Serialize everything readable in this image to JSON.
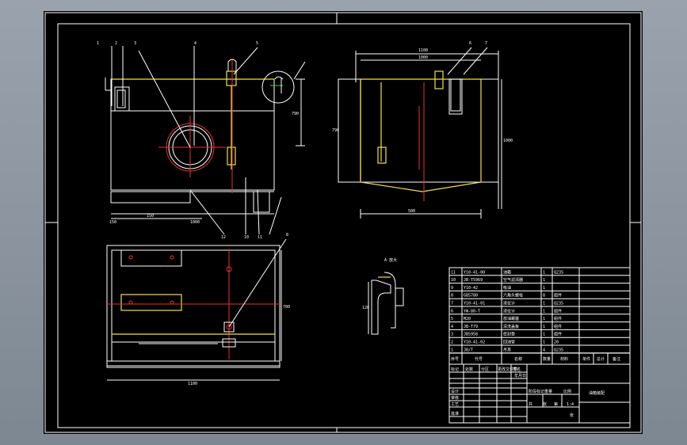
{
  "window": {
    "background": "#8a939d",
    "sheet_color": "#000000"
  },
  "colors": {
    "outline": "#ffffff",
    "tank_yellow": "#f2e04a",
    "centerline_red": "#e8322c",
    "accent_green": "#3ad13a"
  },
  "front_view": {
    "callouts": [
      "1",
      "2",
      "3",
      "4",
      "5"
    ],
    "dims": {
      "height": "790",
      "bottom_left": "150",
      "bottom_mid": "150",
      "bottom_right": "1000"
    },
    "bottom_callouts": [
      "12",
      "10",
      "11"
    ]
  },
  "side_view": {
    "callouts": [
      "6",
      "7"
    ],
    "dims": {
      "top_outer": "1100",
      "top_inner": "1000",
      "height_right": "1000",
      "height_left": "790",
      "bottom": "500"
    }
  },
  "plan_view": {
    "callout": "8",
    "dims": {
      "bottom": "1100",
      "right": "700"
    }
  },
  "detail": {
    "title": "A 放大",
    "dim": "120"
  },
  "bom": {
    "rows": [
      [
        "11",
        "Y10-41-00",
        "油箱",
        "1",
        "Q235"
      ],
      [
        "10",
        "JB-T5969",
        "空气滤清器",
        "1",
        ""
      ],
      [
        "9",
        "Y10-42",
        "吸油",
        "1",
        ""
      ],
      [
        "8",
        "GB5780",
        "六角头螺栓",
        "8",
        "组件"
      ],
      [
        "7",
        "Y10-41-01",
        "液位计",
        "1",
        "Q235"
      ],
      [
        "6",
        "YW-80-T",
        "液位计",
        "1",
        "组件"
      ],
      [
        "5",
        "M20",
        "放油螺塞",
        "1",
        "组件"
      ],
      [
        "4",
        "JB-T79",
        "清洗盖板",
        "1",
        "组件"
      ],
      [
        "3",
        "JB5958",
        "密封垫",
        "1",
        "组件"
      ],
      [
        "2",
        "Y10-41-02",
        "回油管",
        "1",
        "20"
      ],
      [
        "1",
        "JB/T",
        "吊耳",
        "4",
        "Q235"
      ]
    ],
    "header": [
      "序号",
      "代号",
      "名称",
      "数量",
      "材料",
      "单件",
      "总计",
      "备注"
    ]
  },
  "title_block": {
    "drawing_name": "油箱装配",
    "scale": "1:4",
    "labels": [
      "标记",
      "处数",
      "分区",
      "更改文件号",
      "签名",
      "年月日",
      "设计",
      "审核",
      "工艺",
      "批准",
      "阶段标记",
      "重量",
      "比例",
      "共",
      "张",
      "第",
      "张"
    ]
  }
}
